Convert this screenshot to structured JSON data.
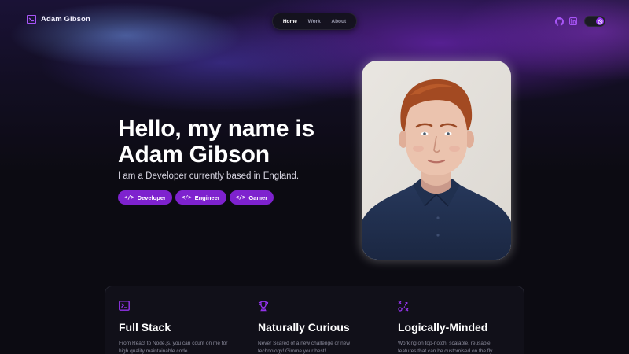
{
  "header": {
    "brand_name": "Adam Gibson",
    "nav": [
      {
        "label": "Home",
        "active": true
      },
      {
        "label": "Work",
        "active": false
      },
      {
        "label": "About",
        "active": false
      }
    ],
    "social_icons": [
      "github-icon",
      "linkedin-icon"
    ],
    "theme_toggle": {
      "state": "dark",
      "icon": "moon-icon"
    }
  },
  "hero": {
    "title_line1": "Hello, my name is",
    "title_line2": "Adam Gibson",
    "subtitle": "I am a Developer currently based in England.",
    "tags": [
      {
        "icon": "</>",
        "label": "Developer"
      },
      {
        "icon": "</>",
        "label": "Engineer"
      },
      {
        "icon": "</>",
        "label": "Gamer"
      }
    ]
  },
  "features": [
    {
      "icon": "terminal-icon",
      "title": "Full Stack",
      "desc": "From React to Node.js, you can count on me for high quality maintainable code."
    },
    {
      "icon": "trophy-icon",
      "title": "Naturally Curious",
      "desc": "Never Scared of a new challenge or new technology! Gimme your best!"
    },
    {
      "icon": "strategy-icon",
      "title": "Logically-Minded",
      "desc": "Working on top-notch, scalable, reusable features that can be customised on the fly."
    }
  ],
  "colors": {
    "accent": "#7e22ce",
    "accent_light": "#a855f7",
    "background": "#0c0b12",
    "card": "#111019"
  }
}
